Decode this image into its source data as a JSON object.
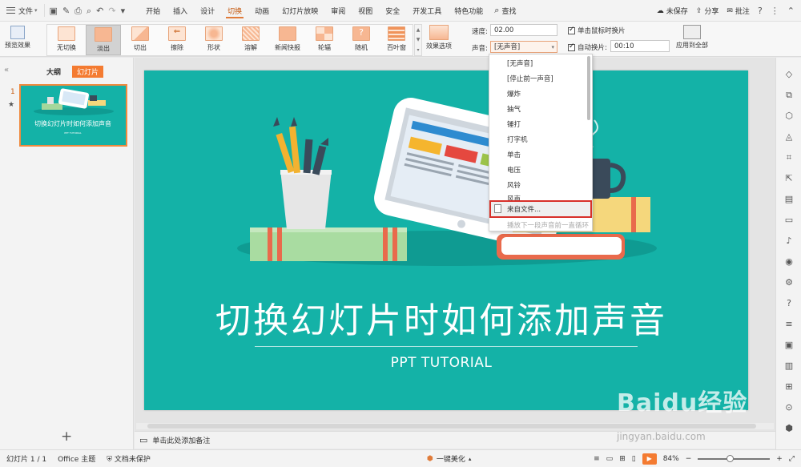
{
  "menu": {
    "file_label": "文件",
    "tabs": [
      "开始",
      "插入",
      "设计",
      "切换",
      "动画",
      "幻灯片放映",
      "审阅",
      "视图",
      "安全",
      "开发工具",
      "特色功能"
    ],
    "active_tab": "切换",
    "search_label": "查找",
    "unsaved": "未保存",
    "share": "分享",
    "comment": "批注"
  },
  "ribbon": {
    "preview_label": "预览效果",
    "effects": [
      "无切换",
      "淡出",
      "切出",
      "擦除",
      "形状",
      "溶解",
      "新闻快报",
      "轮辐",
      "随机",
      "百叶窗"
    ],
    "selected_effect": "淡出",
    "effect_options": "效果选项",
    "speed_label": "速度:",
    "speed_value": "02.00",
    "sound_label": "声音:",
    "sound_value": "[无声音]",
    "click_advance": "单击鼠标时换片",
    "auto_advance": "自动换片:",
    "auto_time": "00:10",
    "apply_all": "应用到全部"
  },
  "left_panel": {
    "outline_tab": "大纲",
    "slides_tab": "幻灯片",
    "slide_number": "1",
    "thumb_title": "切换幻灯片时如何添加声音",
    "thumb_sub": "PPT TUTORIAL"
  },
  "slide": {
    "title": "切换幻灯片时如何添加声音",
    "subtitle": "PPT TUTORIAL"
  },
  "sound_dropdown": {
    "items": [
      "[无声音]",
      "[停止前一声音]",
      "爆炸",
      "抽气",
      "锤打",
      "打字机",
      "单击",
      "电压",
      "风铃",
      "风声"
    ],
    "from_file": "来自文件...",
    "loop_label": "播放下一段声音前一直循环"
  },
  "notes_placeholder": "单击此处添加备注",
  "status": {
    "slide_count": "幻灯片 1 / 1",
    "theme": "Office 主题",
    "protection": "文档未保护",
    "beautify": "一键美化",
    "zoom": "84%"
  },
  "watermark": {
    "brand": "Baidu经验",
    "url": "jingyan.baidu.com"
  },
  "colors": {
    "accent": "#f47b31",
    "slide_bg": "#14b2a7",
    "highlight_box": "#d8302a"
  }
}
